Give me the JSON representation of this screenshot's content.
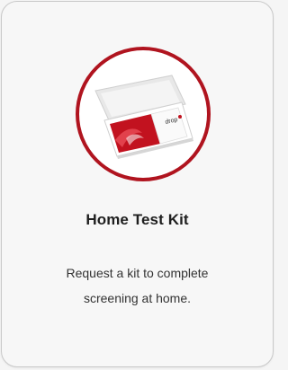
{
  "card": {
    "title": "Home Test Kit",
    "description": "Request a kit to complete screening at home.",
    "image_icon": "test-kit-box-icon",
    "kit_brand_text": "drop"
  },
  "colors": {
    "accent": "#b0141f",
    "card_background": "#f7f7f7",
    "card_border": "#c9c9c9",
    "title_text": "#1f1f1f",
    "body_text": "#333333"
  }
}
